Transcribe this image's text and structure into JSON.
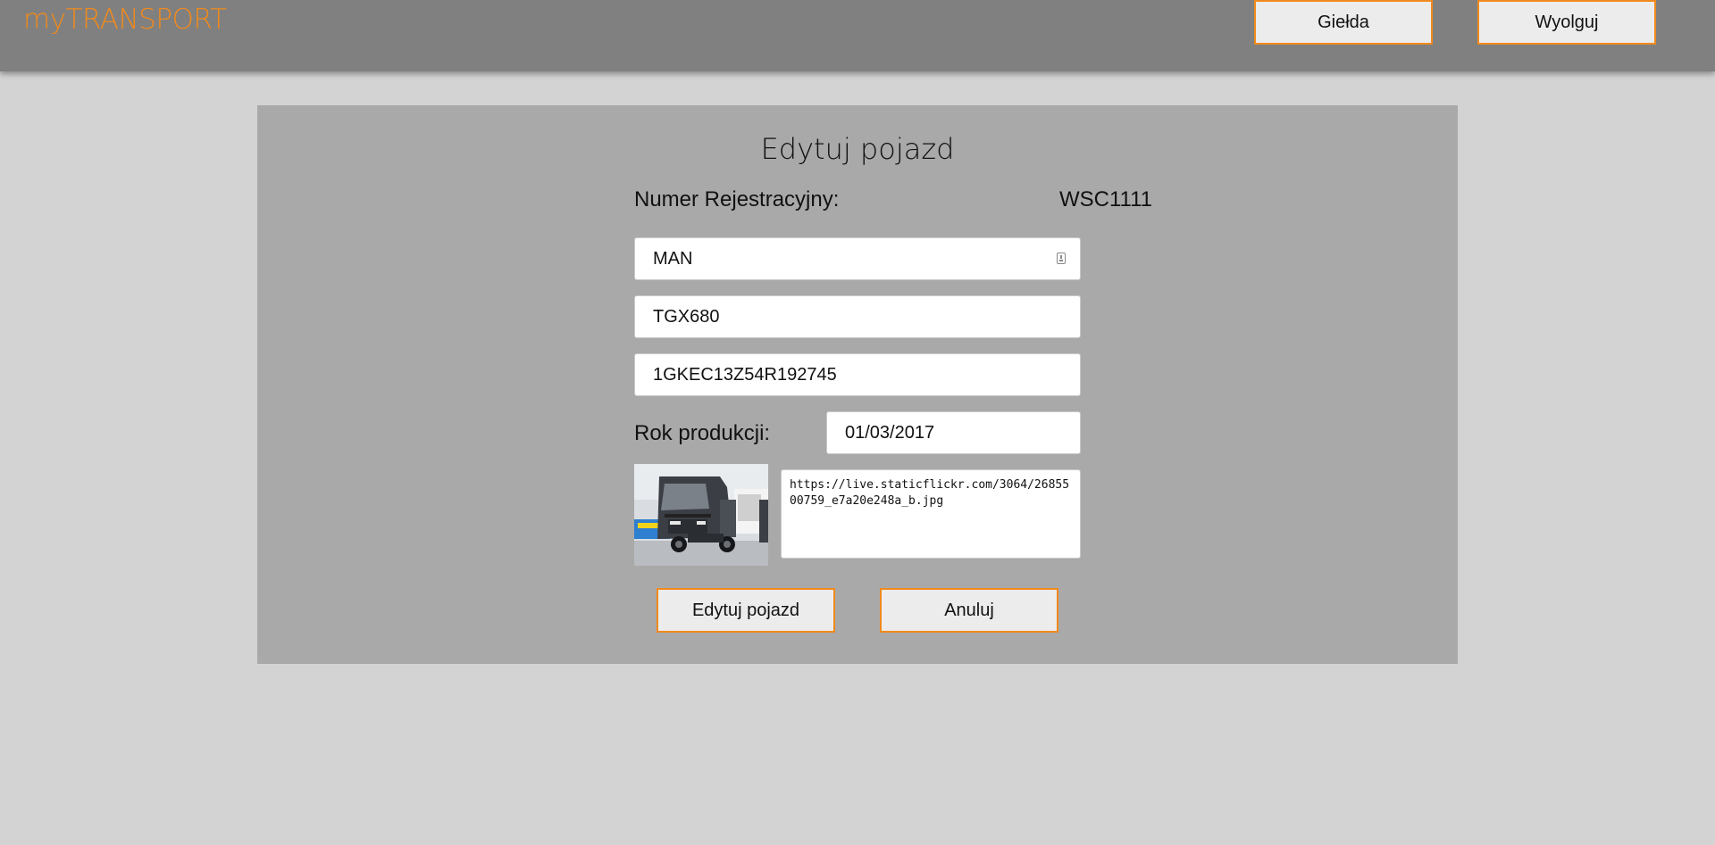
{
  "header": {
    "brand": "myTRANSPORT",
    "nav": {
      "gielda_label": "Giełda",
      "logout_label": "Wyolguj"
    }
  },
  "form": {
    "title": "Edytuj pojazd",
    "registration_label": "Numer Rejestracyjny:",
    "registration_value": "WSC1111",
    "brand_value": "MAN",
    "model_value": "TGX680",
    "vin_value": "1GKEC13Z54R192745",
    "year_label": "Rok produkcji:",
    "year_value": "01/03/2017",
    "image_url": "https://live.staticflickr.com/3064/2685500759_e7a20e248a_b.jpg",
    "submit_label": "Edytuj pojazd",
    "cancel_label": "Anuluj"
  },
  "icons": {
    "autofill": "autofill-contact-icon"
  },
  "colors": {
    "accent": "#f08a1c",
    "topbar": "#808080",
    "panel": "#a9a9a9",
    "background": "#d3d3d3"
  }
}
